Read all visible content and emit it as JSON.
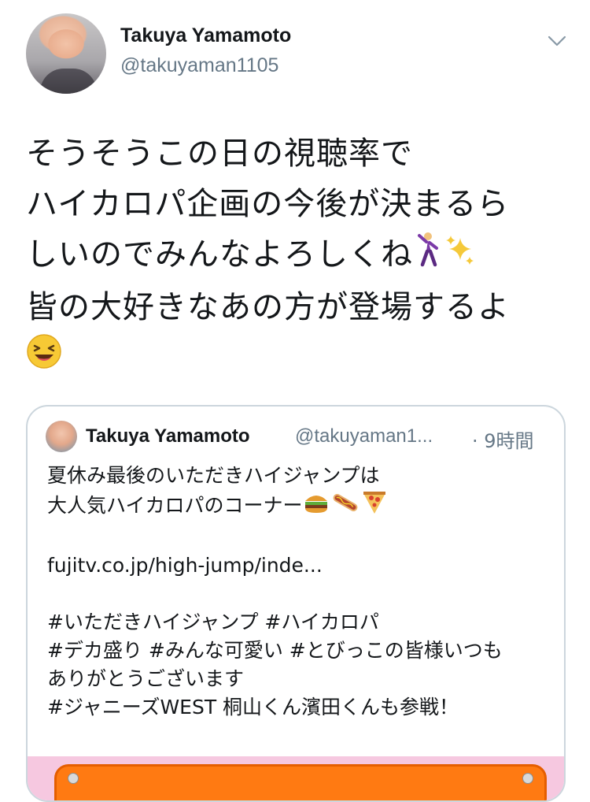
{
  "tweet": {
    "author_name": "Takuya Yamamoto",
    "author_handle": "@takuyaman1105",
    "text_lines": [
      "そうそうこの日の視聴率で",
      "ハイカロパ企画の今後が決まるら",
      "しいのでみんなよろしくね",
      "皆の大好きなあの方が登場するよ"
    ],
    "emojis": [
      "dancing-man",
      "sparkles",
      "laughing-face"
    ]
  },
  "quoted_tweet": {
    "author_name": "Takuya Yamamoto",
    "author_handle": "@takuyaman1...",
    "time": "· 9時間",
    "text_lines": [
      "夏休み最後のいただきハイジャンプは",
      "大人気ハイカロパのコーナー",
      "",
      "fujitv.co.jp/high-jump/inde...",
      "",
      "#いただきハイジャンプ #ハイカロパ",
      "#デカ盛り #みんな可愛い #とびっこの皆様いつも",
      "ありがとうございます",
      " #ジャニーズWEST 桐山くん濱田くんも参戦！"
    ],
    "emojis": [
      "hamburger",
      "hot-dog",
      "pizza"
    ]
  },
  "colors": {
    "text": "#14171a",
    "secondary": "#657786",
    "border": "#ccd6dd",
    "image_bg": "#f6c8e0",
    "board_orange": "#ff7a12"
  }
}
